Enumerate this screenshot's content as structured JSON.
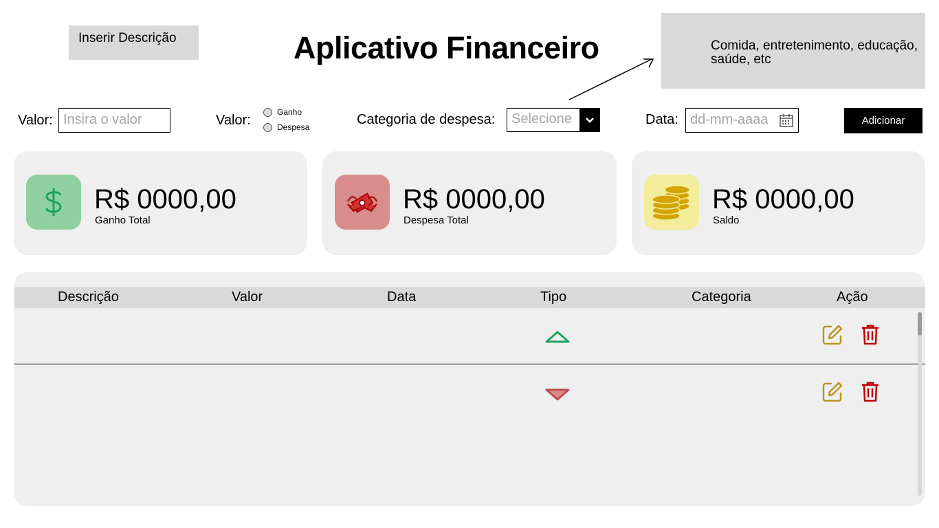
{
  "header": {
    "description_note": "Inserir Descrição",
    "title": "Aplicativo Financeiro",
    "category_note": "Comida, entretenimento, educação, saúde, etc"
  },
  "form": {
    "value_label": "Valor:",
    "value_placeholder": "Insira o valor",
    "type_label": "Valor:",
    "type_options": [
      "Ganho",
      "Despesa"
    ],
    "category_label": "Categoria de despesa:",
    "category_placeholder": "Selecione",
    "date_label": "Data:",
    "date_placeholder": "dd-mm-aaaa",
    "add_button": "Adicionar"
  },
  "summary": {
    "income": {
      "value": "R$ 0000,00",
      "label": "Ganho Total",
      "icon": "dollar-icon",
      "color": "#8fd19e"
    },
    "expense": {
      "value": "R$ 0000,00",
      "label": "Despesa Total",
      "icon": "money-flying-icon",
      "color": "#d98c8c"
    },
    "balance": {
      "value": "R$ 0000,00",
      "label": "Saldo",
      "icon": "coins-icon",
      "color": "#f2ec9b"
    }
  },
  "table": {
    "columns": [
      "Descrição",
      "Valor",
      "Data",
      "Tipo",
      "Categoria",
      "Ação"
    ],
    "rows": [
      {
        "type": "up-arrow-icon"
      },
      {
        "type": "down-arrow-icon"
      }
    ]
  },
  "colors": {
    "accent_green": "#1fa35c",
    "accent_red": "#c0504d",
    "edit_gold": "#b8961e",
    "delete_red": "#c00000"
  }
}
